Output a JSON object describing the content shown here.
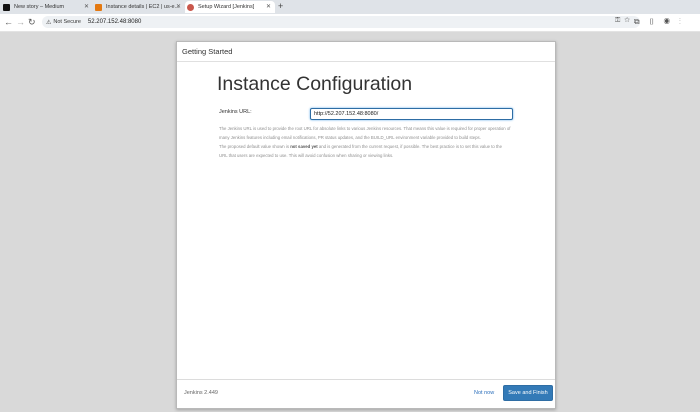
{
  "browser": {
    "tabs": [
      {
        "title": "New story – Medium",
        "favicon": "medium-icon",
        "color": "#111111"
      },
      {
        "title": "Instance details | EC2 | us-e...",
        "favicon": "aws-icon",
        "color": "#e47911"
      },
      {
        "title": "Setup Wizard [Jenkins]",
        "favicon": "jenkins-icon",
        "color": "#c9574c"
      }
    ],
    "new_tab": "+",
    "security": "Not Secure",
    "url": "52.207.152.48:8080"
  },
  "wizard": {
    "header": "Getting Started",
    "title": "Instance Configuration",
    "field_label": "Jenkins URL:",
    "field_value": "http://52.207.152.48:8080/",
    "help_1": "The Jenkins URL is used to provide the root URL for absolute links to various Jenkins resources. That means this value is required for proper operation of many Jenkins features including email notifications, PR status updates, and the BUILD_URL environment variable provided to build steps.",
    "help_2_pre": "The proposed default value shown is ",
    "help_2_bold": "not saved yet",
    "help_2_post": " and is generated from the current request, if possible. The best practice is to set this value to the URL that users are expected to use. This will avoid confusion when sharing or viewing links.",
    "version": "Jenkins 2.449",
    "not_now": "Not now",
    "save": "Save and Finish"
  }
}
